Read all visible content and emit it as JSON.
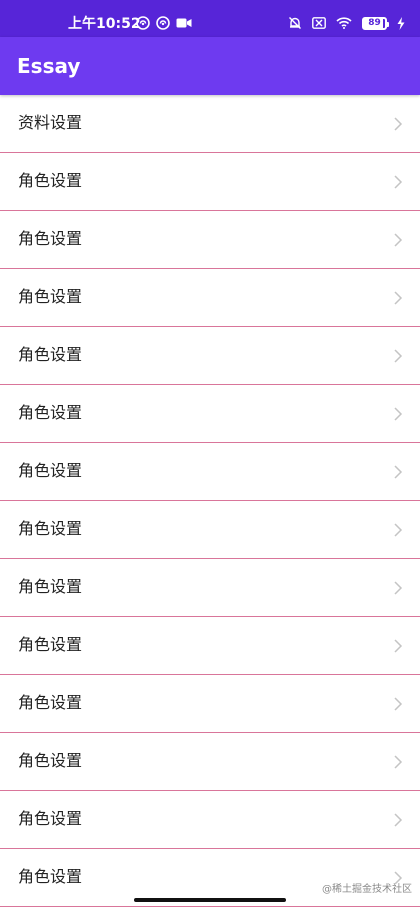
{
  "status_bar": {
    "time": "上午10:52",
    "battery": "89",
    "icons": [
      "notification-icon",
      "notification-icon",
      "video-camera-icon",
      "bell-off-icon",
      "sim-off-icon",
      "wifi-icon",
      "battery-icon",
      "charging-icon"
    ],
    "background": "#5725d8"
  },
  "app_bar": {
    "title": "Essay",
    "background": "#6e3af0"
  },
  "list": {
    "divider_color": "#d9759a",
    "items": [
      {
        "label": "资料设置"
      },
      {
        "label": "角色设置"
      },
      {
        "label": "角色设置"
      },
      {
        "label": "角色设置"
      },
      {
        "label": "角色设置"
      },
      {
        "label": "角色设置"
      },
      {
        "label": "角色设置"
      },
      {
        "label": "角色设置"
      },
      {
        "label": "角色设置"
      },
      {
        "label": "角色设置"
      },
      {
        "label": "角色设置"
      },
      {
        "label": "角色设置"
      },
      {
        "label": "角色设置"
      },
      {
        "label": "角色设置"
      }
    ]
  },
  "watermark": "@稀土掘金技术社区"
}
